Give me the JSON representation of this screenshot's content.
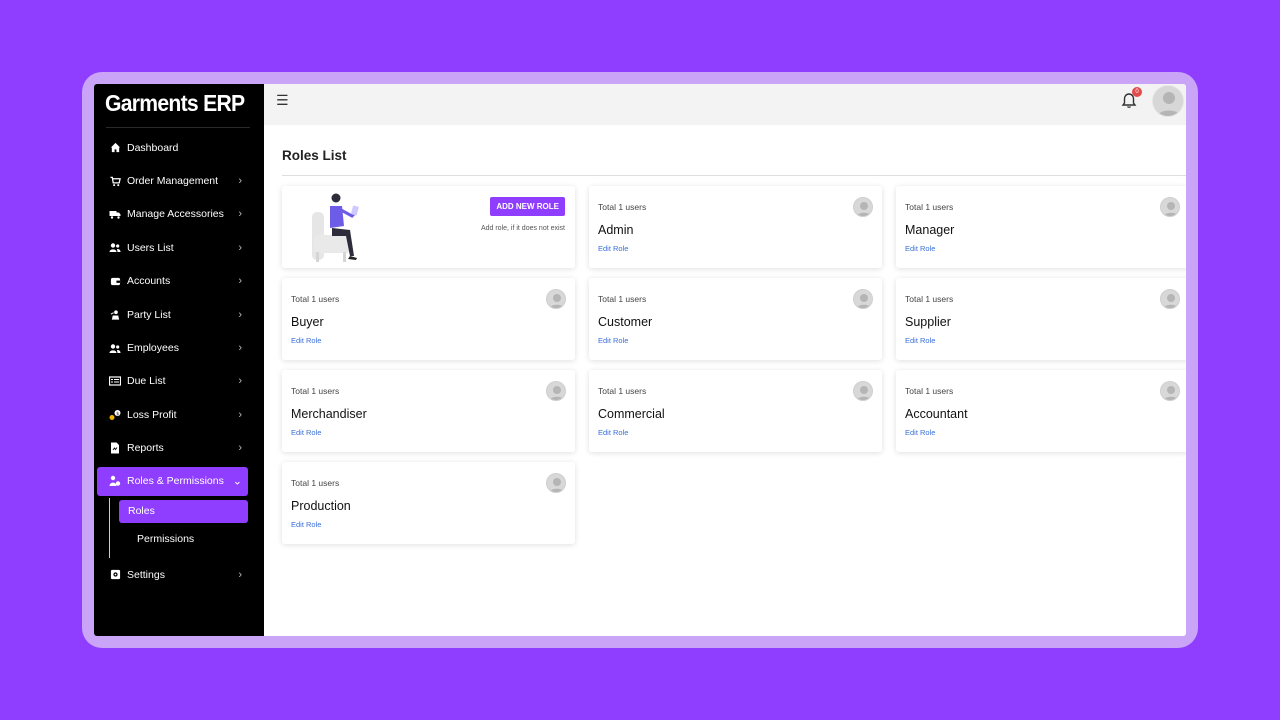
{
  "app": {
    "title": "Garments ERP"
  },
  "sidebar": {
    "items": [
      {
        "label": "Dashboard",
        "icon": "home-icon",
        "chevron": false
      },
      {
        "label": "Order Management",
        "icon": "cart-icon",
        "chevron": true
      },
      {
        "label": "Manage Accessories",
        "icon": "truck-icon",
        "chevron": true
      },
      {
        "label": "Users List",
        "icon": "users-icon",
        "chevron": true
      },
      {
        "label": "Accounts",
        "icon": "wallet-icon",
        "chevron": true
      },
      {
        "label": "Party List",
        "icon": "party-icon",
        "chevron": true
      },
      {
        "label": "Employees",
        "icon": "employees-icon",
        "chevron": true
      },
      {
        "label": "Due List",
        "icon": "list-icon",
        "chevron": true
      },
      {
        "label": "Loss Profit",
        "icon": "money-icon",
        "chevron": true
      },
      {
        "label": "Reports",
        "icon": "report-icon",
        "chevron": true
      },
      {
        "label": "Roles & Permissions",
        "icon": "roles-icon",
        "chevron": true,
        "expanded": true
      },
      {
        "label": "Settings",
        "icon": "settings-icon",
        "chevron": true
      }
    ],
    "subitems": [
      {
        "label": "Roles",
        "active": true
      },
      {
        "label": "Permissions",
        "active": false
      }
    ]
  },
  "topbar": {
    "notification_count": "0"
  },
  "page": {
    "title": "Roles List"
  },
  "add_role": {
    "button_label": "ADD NEW ROLE",
    "hint": "Add role, if it does not exist"
  },
  "roles": [
    {
      "users": "Total 1 users",
      "name": "Admin",
      "edit": "Edit Role"
    },
    {
      "users": "Total 1 users",
      "name": "Manager",
      "edit": "Edit Role"
    },
    {
      "users": "Total 1 users",
      "name": "Buyer",
      "edit": "Edit Role"
    },
    {
      "users": "Total 1 users",
      "name": "Customer",
      "edit": "Edit Role"
    },
    {
      "users": "Total 1 users",
      "name": "Supplier",
      "edit": "Edit Role"
    },
    {
      "users": "Total 1 users",
      "name": "Merchandiser",
      "edit": "Edit Role"
    },
    {
      "users": "Total 1 users",
      "name": "Commercial",
      "edit": "Edit Role"
    },
    {
      "users": "Total 1 users",
      "name": "Accountant",
      "edit": "Edit Role"
    },
    {
      "users": "Total 1 users",
      "name": "Production",
      "edit": "Edit Role"
    }
  ],
  "colors": {
    "accent": "#8f3dff",
    "link": "#3a6fd8",
    "sidebar_bg": "#000000",
    "badge": "#e24b4b"
  }
}
